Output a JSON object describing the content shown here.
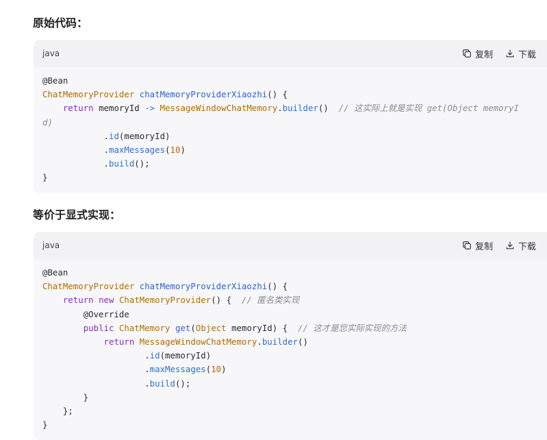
{
  "section1": {
    "heading": "原始代码：",
    "lang": "java",
    "copy_label": "复制",
    "download_label": "下载",
    "lines": [
      [
        {
          "c": "pl",
          "t": "@Bean"
        }
      ],
      [
        {
          "c": "ty",
          "t": "ChatMemoryProvider"
        },
        {
          "c": "pl",
          "t": " "
        },
        {
          "c": "fn",
          "t": "chatMemoryProviderXiaozhi"
        },
        {
          "c": "pl",
          "t": "() {"
        }
      ],
      [
        {
          "c": "pl",
          "t": "    "
        },
        {
          "c": "kw",
          "t": "return"
        },
        {
          "c": "pl",
          "t": " memoryId "
        },
        {
          "c": "op",
          "t": "->"
        },
        {
          "c": "pl",
          "t": " "
        },
        {
          "c": "ty",
          "t": "MessageWindowChatMemory"
        },
        {
          "c": "pl",
          "t": "."
        },
        {
          "c": "mt",
          "t": "builder"
        },
        {
          "c": "pl",
          "t": "()  "
        },
        {
          "c": "cm",
          "t": "// 这实际上就是实现 get(Object memoryI"
        }
      ],
      [
        {
          "c": "cm",
          "t": "d)"
        }
      ],
      [
        {
          "c": "pl",
          "t": "            ."
        },
        {
          "c": "mt",
          "t": "id"
        },
        {
          "c": "pl",
          "t": "(memoryId)"
        }
      ],
      [
        {
          "c": "pl",
          "t": "            ."
        },
        {
          "c": "mt",
          "t": "maxMessages"
        },
        {
          "c": "pl",
          "t": "("
        },
        {
          "c": "nm",
          "t": "10"
        },
        {
          "c": "pl",
          "t": ")"
        }
      ],
      [
        {
          "c": "pl",
          "t": "            ."
        },
        {
          "c": "mt",
          "t": "build"
        },
        {
          "c": "pl",
          "t": "();"
        }
      ],
      [
        {
          "c": "pl",
          "t": "}"
        }
      ]
    ]
  },
  "section2": {
    "heading": "等价于显式实现：",
    "lang": "java",
    "copy_label": "复制",
    "download_label": "下载",
    "lines": [
      [
        {
          "c": "pl",
          "t": "@Bean"
        }
      ],
      [
        {
          "c": "ty",
          "t": "ChatMemoryProvider"
        },
        {
          "c": "pl",
          "t": " "
        },
        {
          "c": "fn",
          "t": "chatMemoryProviderXiaozhi"
        },
        {
          "c": "pl",
          "t": "() {"
        }
      ],
      [
        {
          "c": "pl",
          "t": "    "
        },
        {
          "c": "kw",
          "t": "return"
        },
        {
          "c": "pl",
          "t": " "
        },
        {
          "c": "kw",
          "t": "new"
        },
        {
          "c": "pl",
          "t": " "
        },
        {
          "c": "ty",
          "t": "ChatMemoryProvider"
        },
        {
          "c": "pl",
          "t": "() {  "
        },
        {
          "c": "cm",
          "t": "// 匿名类实现"
        }
      ],
      [
        {
          "c": "pl",
          "t": "        @Override"
        }
      ],
      [
        {
          "c": "pl",
          "t": "        "
        },
        {
          "c": "kw",
          "t": "public"
        },
        {
          "c": "pl",
          "t": " "
        },
        {
          "c": "ty",
          "t": "ChatMemory"
        },
        {
          "c": "pl",
          "t": " "
        },
        {
          "c": "fn",
          "t": "get"
        },
        {
          "c": "pl",
          "t": "("
        },
        {
          "c": "ty",
          "t": "Object"
        },
        {
          "c": "pl",
          "t": " memoryId) {  "
        },
        {
          "c": "cm",
          "t": "// 这才是您实际实现的方法"
        }
      ],
      [
        {
          "c": "pl",
          "t": "            "
        },
        {
          "c": "kw",
          "t": "return"
        },
        {
          "c": "pl",
          "t": " "
        },
        {
          "c": "ty",
          "t": "MessageWindowChatMemory"
        },
        {
          "c": "pl",
          "t": "."
        },
        {
          "c": "mt",
          "t": "builder"
        },
        {
          "c": "pl",
          "t": "()"
        }
      ],
      [
        {
          "c": "pl",
          "t": "                    ."
        },
        {
          "c": "mt",
          "t": "id"
        },
        {
          "c": "pl",
          "t": "(memoryId)"
        }
      ],
      [
        {
          "c": "pl",
          "t": "                    ."
        },
        {
          "c": "mt",
          "t": "maxMessages"
        },
        {
          "c": "pl",
          "t": "("
        },
        {
          "c": "nm",
          "t": "10"
        },
        {
          "c": "pl",
          "t": ")"
        }
      ],
      [
        {
          "c": "pl",
          "t": "                    ."
        },
        {
          "c": "mt",
          "t": "build"
        },
        {
          "c": "pl",
          "t": "();"
        }
      ],
      [
        {
          "c": "pl",
          "t": "        }"
        }
      ],
      [
        {
          "c": "pl",
          "t": "    };"
        }
      ],
      [
        {
          "c": "pl",
          "t": "}"
        }
      ]
    ]
  },
  "icons": {
    "copy": "copy-icon",
    "download": "download-icon"
  }
}
